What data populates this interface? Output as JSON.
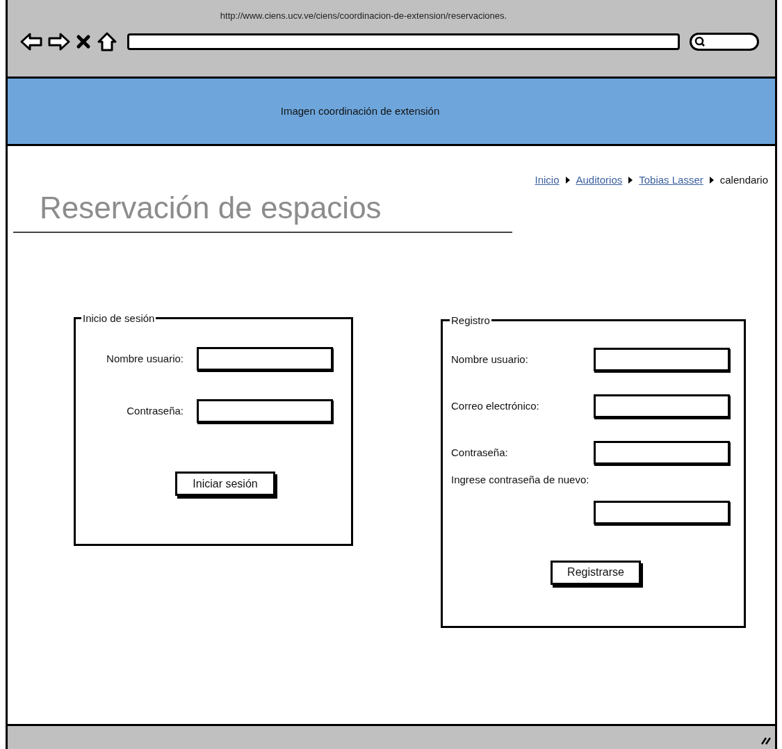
{
  "browser": {
    "url": "http://www.ciens.ucv.ve/ciens/coordinacion-de-extension/reservaciones."
  },
  "header": {
    "text": "Imagen coordinación de extensión"
  },
  "breadcrumb": [
    {
      "label": "Inicio",
      "kind": "link"
    },
    {
      "label": "Auditorios",
      "kind": "link"
    },
    {
      "label": "Tobias Lasser",
      "kind": "link"
    },
    {
      "label": "calendario",
      "kind": "current"
    }
  ],
  "page_title": "Reservación de espacios",
  "login": {
    "legend": "Inicio de sesión",
    "fields": [
      {
        "label": "Nombre usuario:",
        "kind": "inline"
      },
      {
        "label": "Contraseña:",
        "kind": "inline"
      }
    ],
    "button": "Iniciar sesión"
  },
  "register": {
    "legend": "Registro",
    "fields": [
      {
        "label": "Nombre usuario:",
        "kind": "inline"
      },
      {
        "label": "Correo electrónico:",
        "kind": "inline"
      },
      {
        "label": "Contraseña:",
        "kind": "inline"
      },
      {
        "label": "Ingrese contraseña de nuevo:",
        "kind": "stacked"
      }
    ],
    "button": "Registrarse"
  }
}
